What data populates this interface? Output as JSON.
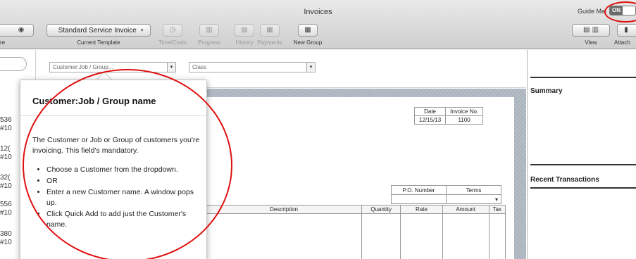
{
  "window": {
    "title": "Invoices"
  },
  "guide_me": {
    "label": "Guide Me",
    "toggle": "ON"
  },
  "toolbar": {
    "left_partial_label": "re",
    "template_button": "Standard Service Invoice",
    "template_label": "Current Template",
    "buttons": [
      {
        "label": "Time/Costs",
        "icon": "clock-icon",
        "enabled": false
      },
      {
        "label": "Progress",
        "icon": "progress-icon",
        "enabled": false
      },
      {
        "label": "History",
        "icon": "history-icon",
        "enabled": false
      },
      {
        "label": "Payments",
        "icon": "payments-icon",
        "enabled": false
      },
      {
        "label": "New Group",
        "icon": "group-icon",
        "enabled": true
      }
    ],
    "right": [
      {
        "label": "View",
        "icon": "view-icon"
      },
      {
        "label": "Attach",
        "icon": "attach-icon"
      }
    ]
  },
  "left_list": {
    "numbers": [
      "536",
      "#10",
      "12(",
      "#10",
      "32(",
      "#10",
      "556",
      "#10",
      "380",
      "#10"
    ]
  },
  "form": {
    "customer_placeholder": "Customer:Job / Group...",
    "class_placeholder": "Class",
    "date_header": "Date",
    "invoice_no_header": "Invoice No.",
    "date_value": "12/15/13",
    "invoice_no_value": "1100",
    "po_header": "P.O. Number",
    "terms_header": "Terms",
    "columns": [
      "Description",
      "Quantity",
      "Rate",
      "Amount",
      "Tax"
    ]
  },
  "right_panel": {
    "summary": "Summary",
    "recent": "Recent Transactions"
  },
  "popover": {
    "title": "Customer:Job / Group name",
    "intro": "The Customer or Job or Group of customers you're invoicing. This field's mandatory.",
    "bullets": [
      "Choose a Customer from the dropdown.",
      "OR",
      "Enter a new Customer name. A window pops up.",
      "Click Quick Add to add just the Customer's name."
    ]
  },
  "annotation_color": "#e01010"
}
